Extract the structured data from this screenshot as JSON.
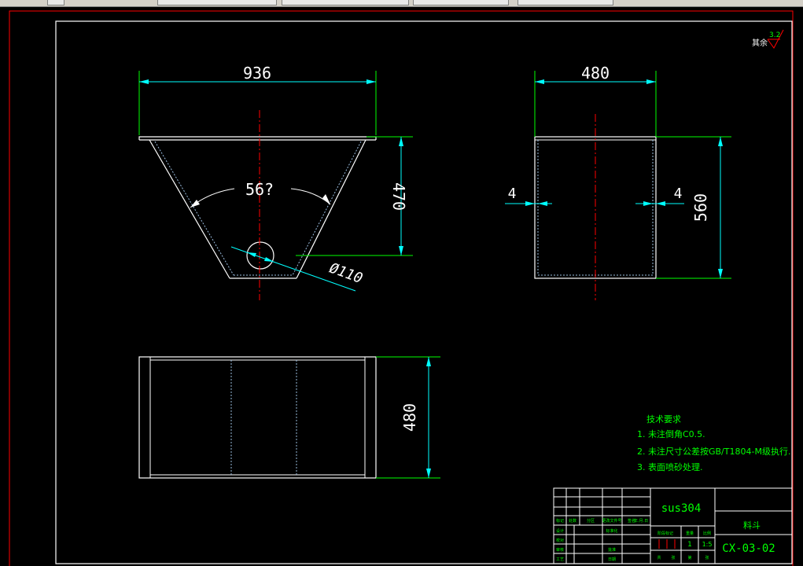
{
  "dimensions": {
    "front_width": "936",
    "front_angle": "56?",
    "front_height": "470",
    "front_hole": "Ø110",
    "side_width": "480",
    "side_height": "560",
    "side_wall_left": "4",
    "side_wall_right": "4",
    "top_depth": "480"
  },
  "roughness": {
    "label": "其余",
    "value": "3.2"
  },
  "tech_requirements": {
    "title": "技术要求",
    "items": [
      "1. 未注倒角C0.5.",
      "2. 未注尺寸公差按GB/T1804-M级执行.",
      "3. 表面喷砂处理."
    ]
  },
  "title_block": {
    "material": "sus304",
    "part_name": "料斗",
    "drawing_no": "CX-03-02",
    "quantity": "1",
    "scale": "1:5",
    "row_labels": [
      "标记",
      "处数",
      "分区",
      "更改文件号",
      "签名",
      "年.月.日"
    ],
    "left_labels": [
      "设计",
      "校对",
      "审核",
      "工艺"
    ],
    "mid_labels": [
      "标准化",
      "批准",
      "日期"
    ],
    "stage_labels": [
      "阶段标记",
      "重量",
      "比例"
    ],
    "sheet_labels": [
      "共",
      "张",
      "第",
      "张"
    ]
  },
  "colors": {
    "outline": "#ffffff",
    "dimension": "#00ffff",
    "extension": "#00ff00",
    "centerline": "#ff0000",
    "annotation": "#00ff00",
    "border": "#ffffff",
    "outer_border": "#ff0000"
  }
}
